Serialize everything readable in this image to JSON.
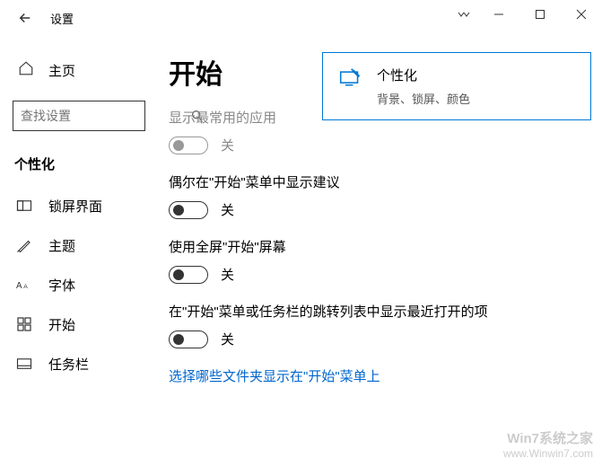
{
  "titlebar": {
    "title": "设置"
  },
  "sidebar": {
    "home": "主页",
    "search_placeholder": "查找设置",
    "section": "个性化",
    "items": [
      {
        "label": "锁屏界面"
      },
      {
        "label": "主题"
      },
      {
        "label": "字体"
      },
      {
        "label": "开始"
      },
      {
        "label": "任务栏"
      }
    ]
  },
  "main": {
    "title": "开始",
    "settings": [
      {
        "label": "显示最常用的应用",
        "state": "关",
        "disabled": true
      },
      {
        "label": "偶尔在\"开始\"菜单中显示建议",
        "state": "关",
        "disabled": false
      },
      {
        "label": "使用全屏\"开始\"屏幕",
        "state": "关",
        "disabled": false
      },
      {
        "label": "在\"开始\"菜单或任务栏的跳转列表中显示最近打开的项",
        "state": "关",
        "disabled": false
      }
    ],
    "link": "选择哪些文件夹显示在\"开始\"菜单上"
  },
  "tip": {
    "title": "个性化",
    "desc": "背景、锁屏、颜色"
  },
  "watermark": {
    "line1": "Win7系统之家",
    "line2": "www.Winwin7.com"
  }
}
